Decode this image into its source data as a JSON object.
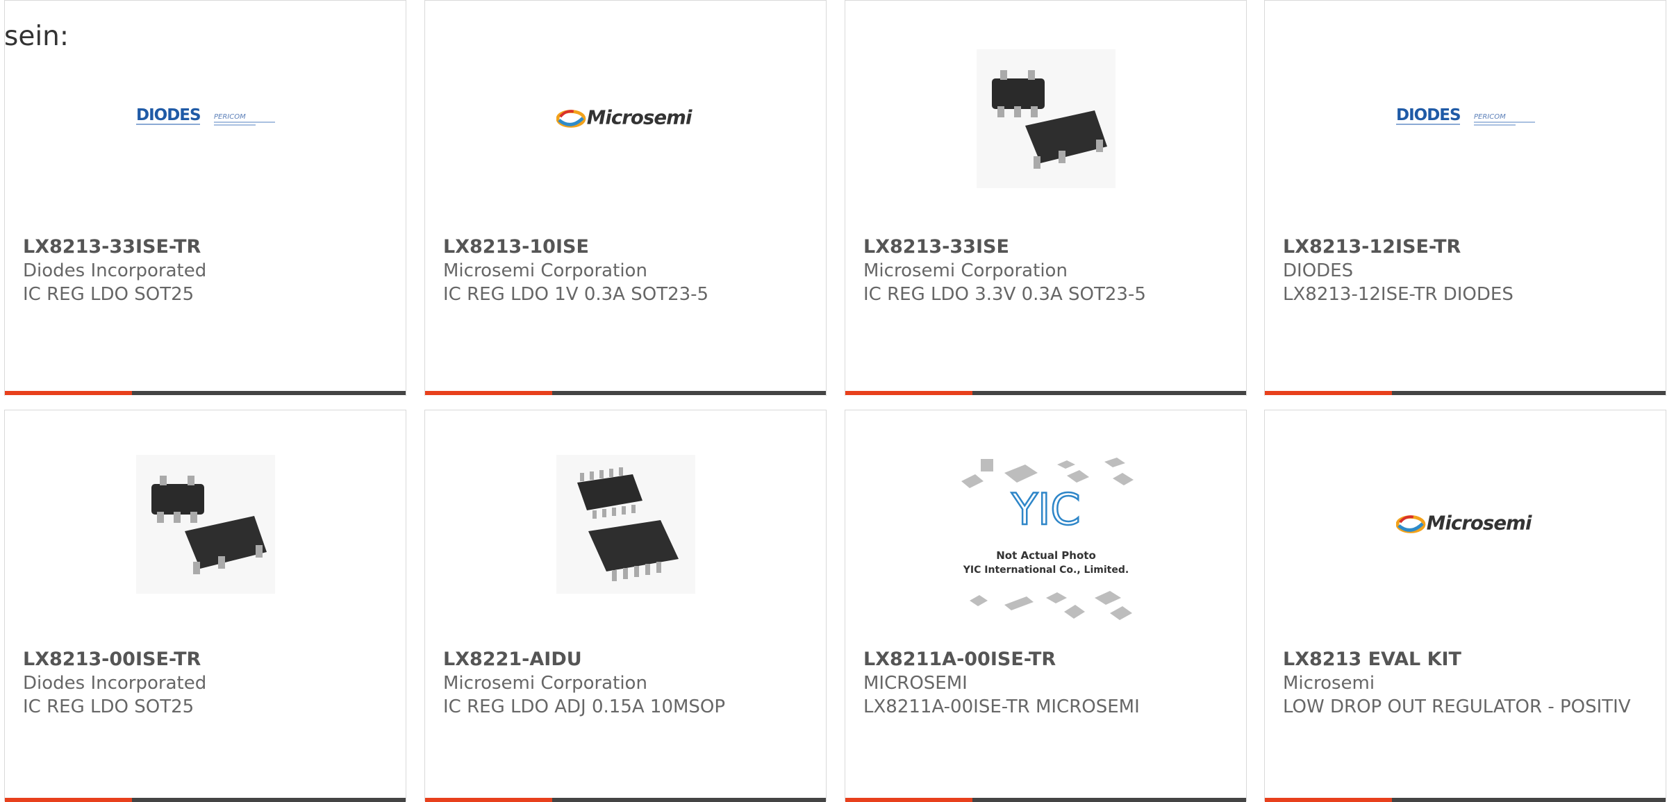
{
  "intro_text": "sein:",
  "colors": {
    "accent": "#e8401c",
    "bar": "#444444",
    "border": "#d9d9d9",
    "text": "#666666"
  },
  "products": [
    {
      "part": "LX8213-33ISE-TR",
      "manufacturer": "Diodes Incorporated",
      "description": "IC REG LDO SOT25",
      "image": "diodes-pericom-logo",
      "logo_text": "DIODES",
      "logo_sub": "PERICOM"
    },
    {
      "part": "LX8213-10ISE",
      "manufacturer": "Microsemi Corporation",
      "description": "IC REG LDO 1V 0.3A SOT23-5",
      "image": "microsemi-logo",
      "logo_text": "Microsemi"
    },
    {
      "part": "LX8213-33ISE",
      "manufacturer": "Microsemi Corporation",
      "description": "IC REG LDO 3.3V 0.3A SOT23-5",
      "image": "sot23-5-package-photo"
    },
    {
      "part": "LX8213-12ISE-TR",
      "manufacturer": "DIODES",
      "description": "LX8213-12ISE-TR DIODES",
      "image": "diodes-pericom-logo",
      "logo_text": "DIODES",
      "logo_sub": "PERICOM"
    },
    {
      "part": "LX8213-00ISE-TR",
      "manufacturer": "Diodes Incorporated",
      "description": "IC REG LDO SOT25",
      "image": "sot23-5-package-photo"
    },
    {
      "part": "LX8221-AIDU",
      "manufacturer": "Microsemi Corporation",
      "description": "IC REG LDO ADJ 0.15A 10MSOP",
      "image": "msop-10-package-photo"
    },
    {
      "part": "LX8211A-00ISE-TR",
      "manufacturer": "MICROSEMI",
      "description": "LX8211A-00ISE-TR MICROSEMI",
      "image": "yic-placeholder-photo",
      "placeholder_line1": "Not Actual Photo",
      "placeholder_line2": "YIC International Co., Limited."
    },
    {
      "part": "LX8213 EVAL KIT",
      "manufacturer": "Microsemi",
      "description": "LOW DROP OUT REGULATOR - POSITIV",
      "image": "microsemi-logo",
      "logo_text": "Microsemi"
    }
  ]
}
